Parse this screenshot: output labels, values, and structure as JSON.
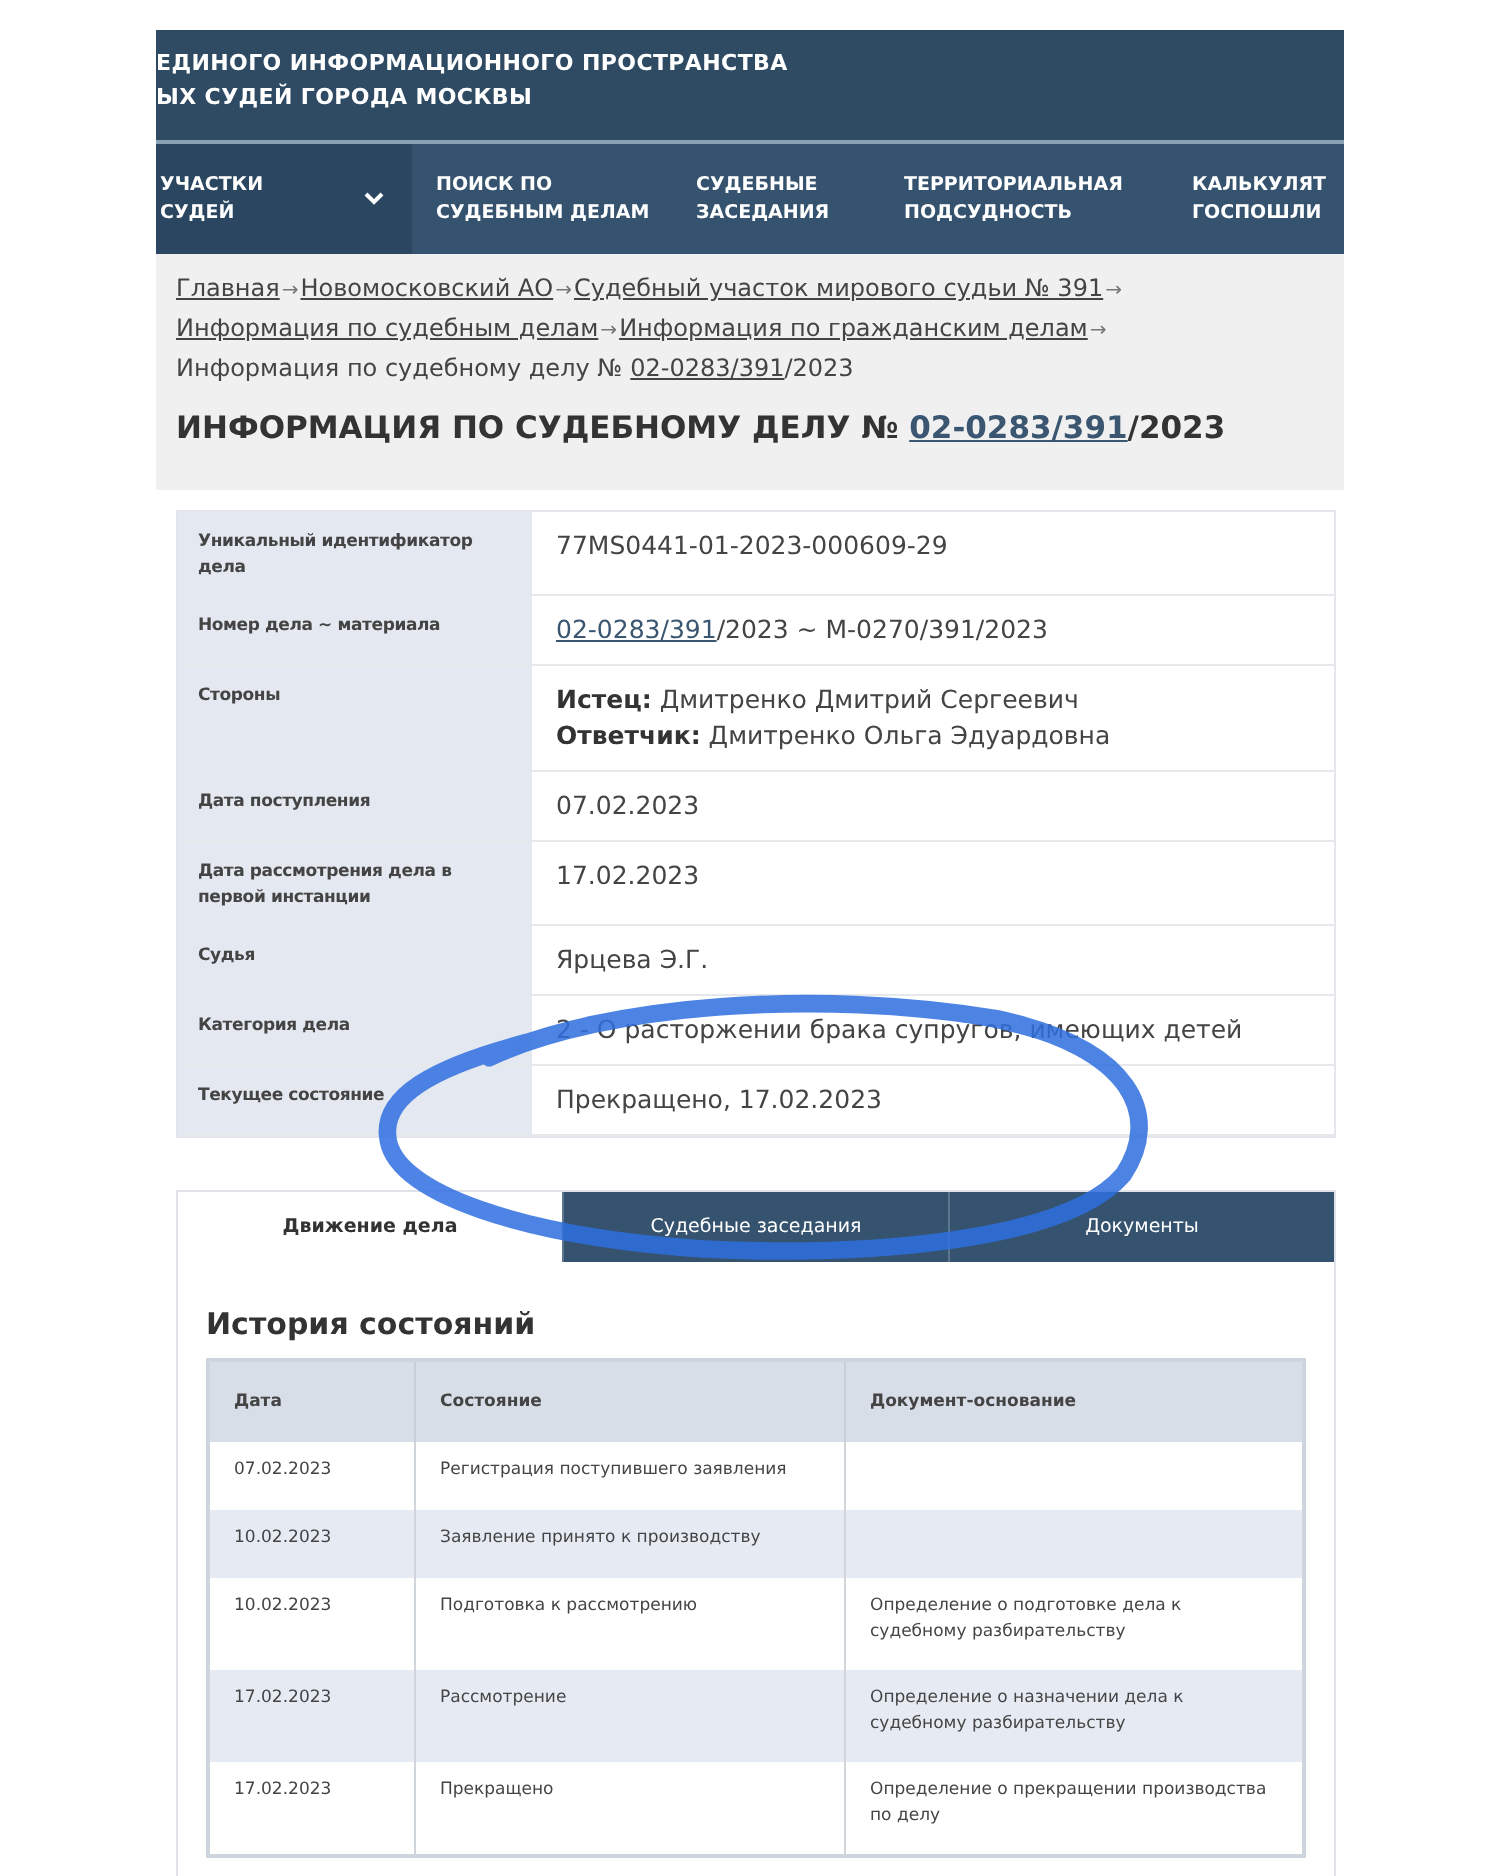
{
  "header": {
    "title_lines": [
      "ЕДИНОГО ИНФОРМАЦИОННОГО ПРОСТРАНСТВА",
      "ЫХ СУДЕЙ ГОРОДА МОСКВЫ"
    ]
  },
  "nav": [
    {
      "label": "УЧАСТКИ СУДЕЙ",
      "selected": true,
      "dropdown": true
    },
    {
      "label": "ПОИСК ПО СУДЕБНЫМ ДЕЛАМ",
      "selected": false,
      "dropdown": false
    },
    {
      "label": "СУДЕБНЫЕ ЗАСЕДАНИЯ",
      "selected": false,
      "dropdown": false
    },
    {
      "label": "ТЕРРИТОРИАЛЬНАЯ ПОДСУДНОСТЬ",
      "selected": false,
      "dropdown": false
    },
    {
      "label": "КАЛЬКУЛЯТ ГОСПОШЛИ",
      "selected": false,
      "dropdown": false
    }
  ],
  "breadcrumb": [
    {
      "kind": "link",
      "text": "Главная"
    },
    {
      "kind": "sep",
      "text": "→"
    },
    {
      "kind": "link",
      "text": "Новомосковский АО"
    },
    {
      "kind": "sep",
      "text": "→"
    },
    {
      "kind": "link",
      "text": "Судебный участок мирового судьи № 391"
    },
    {
      "kind": "sep",
      "text": "→"
    },
    {
      "kind": "link",
      "text": "Информация по судебным делам"
    },
    {
      "kind": "sep",
      "text": "→"
    },
    {
      "kind": "link",
      "text": "Информация по гражданским делам"
    },
    {
      "kind": "sep",
      "text": "→"
    },
    {
      "kind": "text",
      "text": "Информация по судебному делу №"
    },
    {
      "kind": "link",
      "text": "02-0283/391"
    },
    {
      "kind": "text",
      "text": "/2023"
    }
  ],
  "page_title": {
    "before": "ИНФОРМАЦИЯ ПО СУДЕБНОМУ ДЕЛУ № ",
    "link": "02-0283/391",
    "after": "/2023"
  },
  "case_info": [
    {
      "label": "Уникальный идентификатор дела",
      "kind": "text",
      "value": "77MS0441-01-2023-000609-29"
    },
    {
      "label": "Номер дела ~ материала",
      "kind": "linked",
      "link": "02-0283/391",
      "value": "/2023 ~ М-0270/391/2023"
    },
    {
      "label": "Стороны",
      "kind": "lines",
      "lines": [
        "**Истец:** Дмитренко Дмитрий Сергеевич",
        "**Ответчик:** Дмитренко Ольга Эдуардовна"
      ]
    },
    {
      "label": "Дата поступления",
      "kind": "text",
      "value": "07.02.2023"
    },
    {
      "label": "Дата рассмотрения дела в первой инстанции",
      "kind": "text",
      "value": "17.02.2023"
    },
    {
      "label": "Судья",
      "kind": "text",
      "value": "Ярцева Э.Г."
    },
    {
      "label": "Категория дела",
      "kind": "text",
      "value": "2 - О расторжении брака супругов, имеющих детей"
    },
    {
      "label": "Текущее состояние",
      "kind": "text",
      "value": "Прекращено, 17.02.2023"
    }
  ],
  "tabs": [
    {
      "label": "Движение дела",
      "selected": true
    },
    {
      "label": "Судебные заседания",
      "selected": false
    },
    {
      "label": "Документы",
      "selected": false
    }
  ],
  "history": {
    "title": "История состояний",
    "columns": [
      "Дата",
      "Состояние",
      "Документ-основание"
    ],
    "rows": [
      [
        "07.02.2023",
        "Регистрация поступившего заявления",
        ""
      ],
      [
        "10.02.2023",
        "Заявление принято к производству",
        ""
      ],
      [
        "10.02.2023",
        "Подготовка к рассмотрению",
        "Определение о подготовке дела к судебному разбирательству"
      ],
      [
        "17.02.2023",
        "Рассмотрение",
        "Определение о назначении дела к судебному разбирательству"
      ],
      [
        "17.02.2023",
        "Прекращено",
        "Определение о прекращении производства по делу"
      ]
    ]
  },
  "highlight": {
    "kind": "ellipse"
  }
}
